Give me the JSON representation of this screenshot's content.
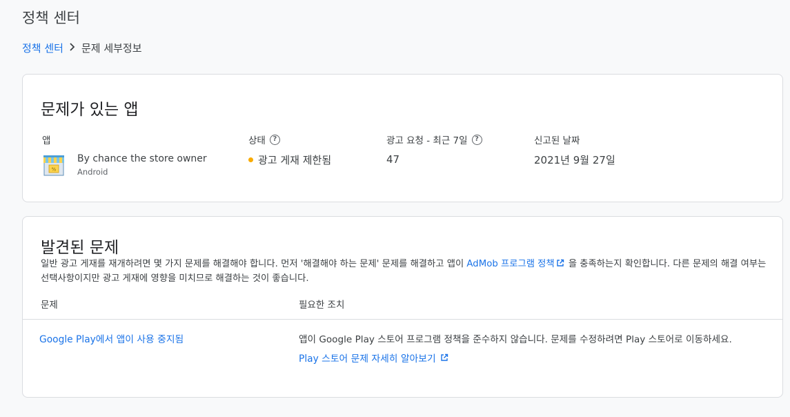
{
  "page": {
    "title": "정책 센터"
  },
  "breadcrumb": {
    "root": "정책 센터",
    "current": "문제 세부정보"
  },
  "apps_card": {
    "title": "문제가 있는 앱",
    "columns": {
      "app": "앱",
      "status": "상태",
      "requests": "광고 요청 - 최근 7일",
      "reported": "신고된 날짜"
    },
    "row": {
      "app_name": "By chance the store owner",
      "platform": "Android",
      "status": "광고 게재 제한됨",
      "status_color": "#f9ab00",
      "requests": "47",
      "reported": "2021년 9월 27일",
      "icon": "store-icon"
    }
  },
  "issues_card": {
    "title": "발견된 문제",
    "desc_part1": "일반 광고 게재를 재개하려면 몇 가지 문제를 해결해야 합니다. 먼저 '해결해야 하는 문제' 문제를 해결하고 앱이 ",
    "desc_link": "AdMob 프로그램 정책",
    "desc_part2": " 을 충족하는지 확인합니다. 다른 문제의 해결 여부는 선택사항이지만 광고 게재에 영향을 미치므로 해결하는 것이 좋습니다.",
    "columns": {
      "issue": "문제",
      "action": "필요한 조치"
    },
    "row": {
      "issue": "Google Play에서 앱이 사용 중지됨",
      "action": "앱이 Google Play 스토어 프로그램 정책을 준수하지 않습니다. 문제를 수정하려면 Play 스토어로 이동하세요.",
      "action_link": "Play 스토어 문제 자세히 알아보기"
    }
  },
  "colors": {
    "link": "#1a73e8",
    "warning": "#f9ab00",
    "border": "#dadce0"
  }
}
